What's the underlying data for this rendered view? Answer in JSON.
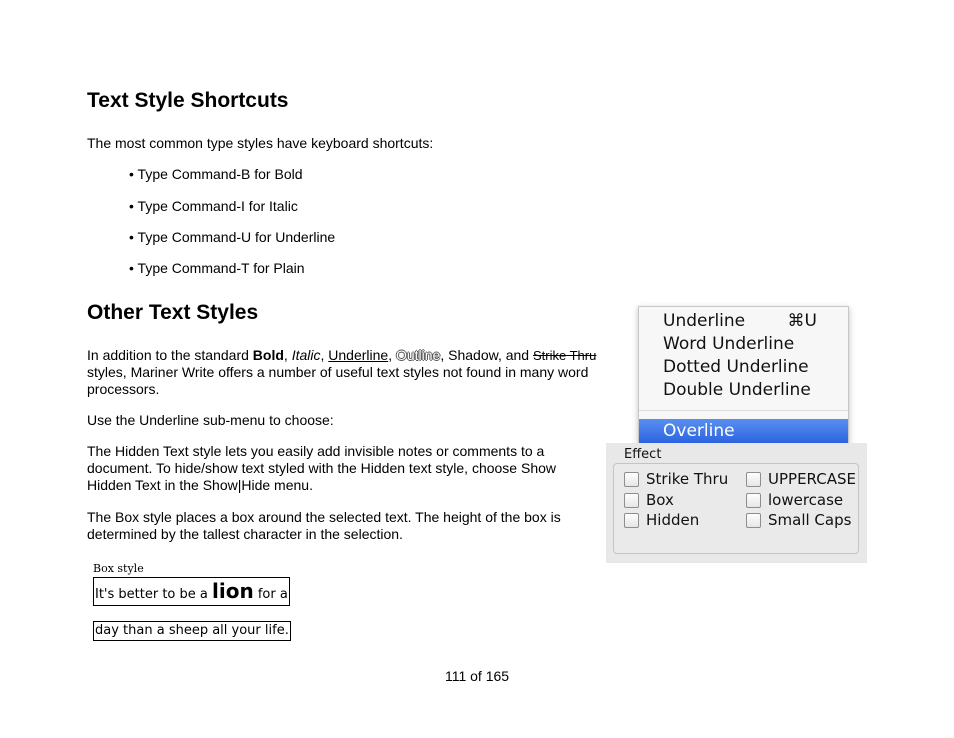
{
  "section1": {
    "heading": "Text Style Shortcuts",
    "intro": "The most common type styles have keyboard shortcuts:",
    "bullets": [
      "• Type Command-B for Bold",
      "• Type Command-I for Italic",
      "• Type Command-U for Underline",
      "• Type Command-T for Plain"
    ]
  },
  "section2": {
    "heading": "Other Text Styles",
    "para1": {
      "lead": "In addition to the standard ",
      "bold": "Bold",
      "sep1": ", ",
      "italic": "Italic",
      "sep2": ", ",
      "underline": "Underline",
      "sep3": ", ",
      "outline": "Outline",
      "sep4": ", Shadow, and ",
      "strike": "Strike Thru",
      "tail": "styles, Mariner Write offers a number of useful text styles not found in many word processors."
    },
    "para2": "Use the Underline sub-menu to choose:",
    "para3": "The Hidden Text style lets you easily add invisible notes or comments to a document. To hide/show text styled with the Hidden text style, choose Show Hidden Text in the Show|Hide menu.",
    "para4": "The Box style places a box around the selected text. The height of the box is determined by the tallest character in the selection."
  },
  "underline_menu": {
    "items": [
      "Underline",
      "Word Underline",
      "Dotted Underline",
      "Double Underline"
    ],
    "shortcut": "⌘U",
    "highlighted": "Overline"
  },
  "effect_panel": {
    "title": "Effect",
    "left_options": [
      "Strike Thru",
      "Box",
      "Hidden"
    ],
    "right_options": [
      "UPPERCASE",
      "lowercase",
      "Small Caps"
    ]
  },
  "box_sample": {
    "caption": "Box style",
    "line1_start": "It's better to be a ",
    "line1_lion": "lion",
    "line1_end": " for a",
    "line2": "day than a sheep all your life."
  },
  "page_number": "111 of 165"
}
